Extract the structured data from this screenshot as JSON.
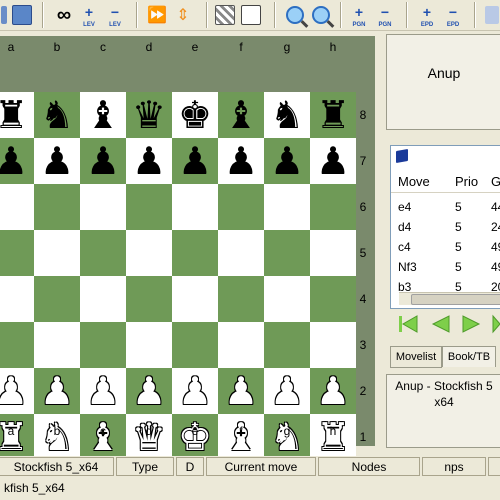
{
  "toolbar": {
    "lev_plus": "LEV",
    "lev_minus": "LEV",
    "pgn_plus": "PGN",
    "pgn_minus": "PGN",
    "epd_plus": "EPD",
    "epd_minus": "EPD"
  },
  "board": {
    "files": [
      "a",
      "b",
      "c",
      "d",
      "e",
      "f",
      "g",
      "h"
    ],
    "ranks": [
      "8",
      "7",
      "6",
      "5",
      "4",
      "3",
      "2",
      "1"
    ],
    "light_color": "#ffffff",
    "dark_color": "#6f9a57",
    "position": [
      [
        "♜",
        "♞",
        "♝",
        "♛",
        "♚",
        "♝",
        "♞",
        "♜"
      ],
      [
        "♟",
        "♟",
        "♟",
        "♟",
        "♟",
        "♟",
        "♟",
        "♟"
      ],
      [
        "",
        "",
        "",
        "",
        "",
        "",
        "",
        ""
      ],
      [
        "",
        "",
        "",
        "",
        "",
        "",
        "",
        ""
      ],
      [
        "",
        "",
        "",
        "",
        "",
        "",
        "",
        ""
      ],
      [
        "",
        "",
        "",
        "",
        "",
        "",
        "",
        ""
      ],
      [
        "♙",
        "♙",
        "♙",
        "♙",
        "♙",
        "♙",
        "♙",
        "♙"
      ],
      [
        "♖",
        "♘",
        "♗",
        "♕",
        "♔",
        "♗",
        "♘",
        "♖"
      ]
    ]
  },
  "player_top": "Anup",
  "movelist": {
    "columns": [
      "Move",
      "Prio",
      "G"
    ],
    "rows": [
      {
        "move": "e4",
        "prio": "5",
        "g": "44"
      },
      {
        "move": "d4",
        "prio": "5",
        "g": "24"
      },
      {
        "move": "c4",
        "prio": "5",
        "g": "49"
      },
      {
        "move": "Nf3",
        "prio": "5",
        "g": "49"
      },
      {
        "move": "b3",
        "prio": "5",
        "g": "20"
      }
    ]
  },
  "tabs": [
    "Movelist",
    "Book/TB"
  ],
  "game_info": {
    "line1": "Anup - Stockfish 5",
    "line2": "x64"
  },
  "status": {
    "engine": "Stockfish 5_x64",
    "type": "Type",
    "d": "D",
    "current_move": "Current move",
    "nodes": "Nodes",
    "nps": "nps"
  },
  "bottom_text": "kfish 5_x64"
}
